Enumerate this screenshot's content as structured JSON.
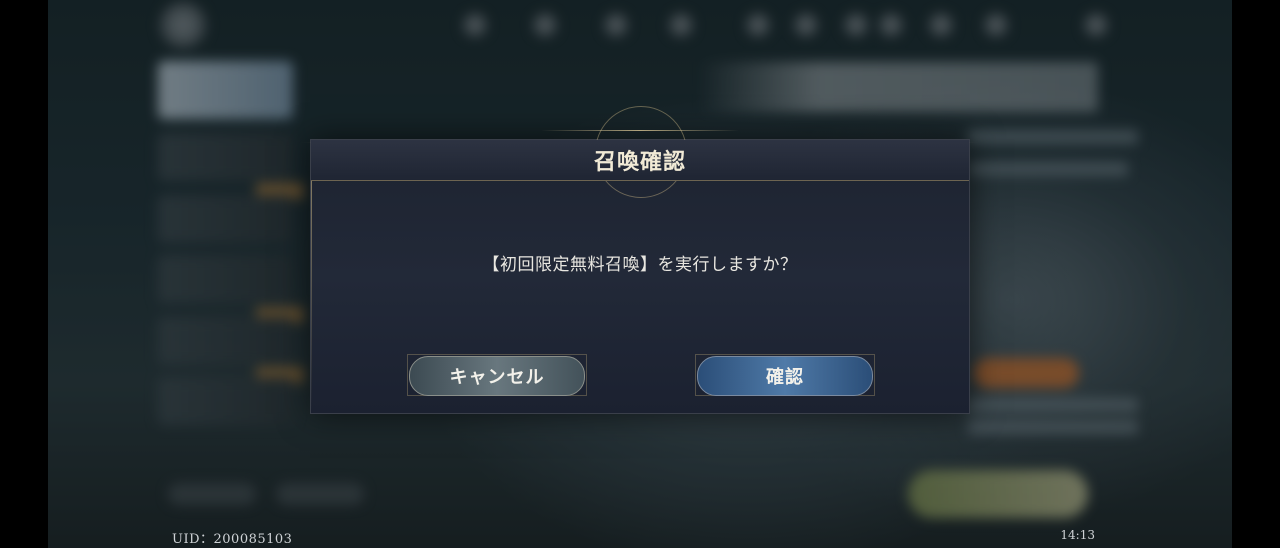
{
  "background": {
    "uid_text": "UID：200085103",
    "clock_text": "14:13"
  },
  "dialog": {
    "title": "召喚確認",
    "message": "【初回限定無料召喚】を実行しますか？",
    "cancel_label": "キャンセル",
    "confirm_label": "確認"
  },
  "colors": {
    "dialog_bg": "#1d2330",
    "title_color": "#f1ead6",
    "confirm_button": "#4f7aa8",
    "cancel_button": "#68777e"
  }
}
